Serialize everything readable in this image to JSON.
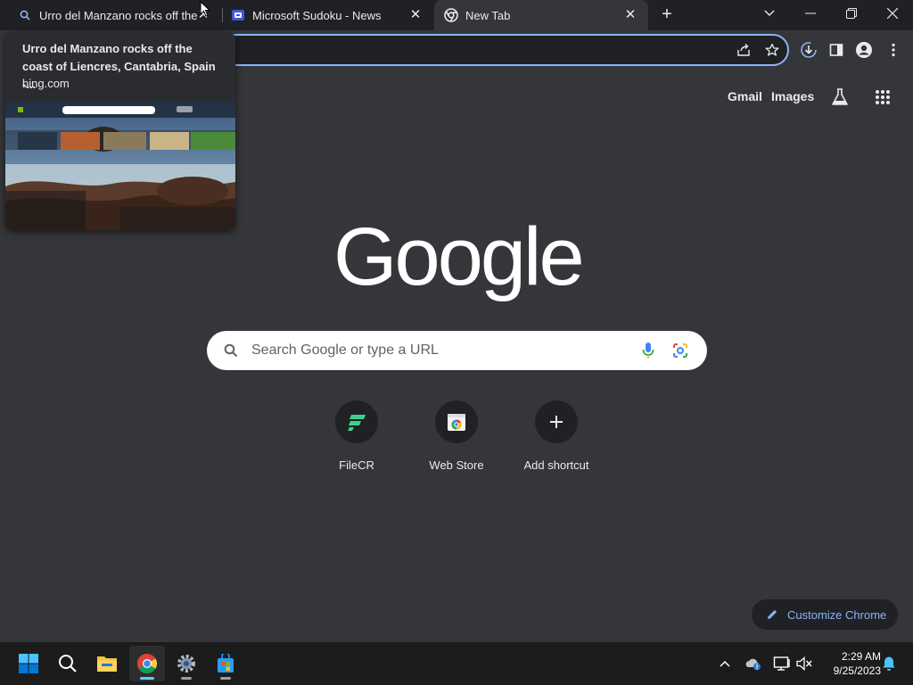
{
  "tabs": [
    {
      "title": "Urro del Manzano rocks off the coast of Liencres, Cantabria, Spain",
      "icon": "search-icon"
    },
    {
      "title": "Microsoft Sudoku - News",
      "icon": "sudoku-icon"
    },
    {
      "title": "New Tab",
      "icon": "chrome-icon"
    }
  ],
  "hovercard": {
    "title": "Urro del Manzano rocks off the coast of Liencres, Cantabria, Spain -...",
    "domain": "bing.com"
  },
  "ntp": {
    "gmail": "Gmail",
    "images": "Images",
    "logo": "Google",
    "search_placeholder": "Search Google or type a URL",
    "shortcuts": [
      {
        "label": "FileCR"
      },
      {
        "label": "Web Store"
      },
      {
        "label": "Add shortcut"
      }
    ],
    "customize": "Customize Chrome"
  },
  "clock": {
    "time": "2:29 AM",
    "date": "9/25/2023"
  },
  "colors": {
    "accent": "#8ab4f8",
    "background": "#35363a",
    "tabstrip": "#202124",
    "taskbar": "#1c1c1c"
  }
}
